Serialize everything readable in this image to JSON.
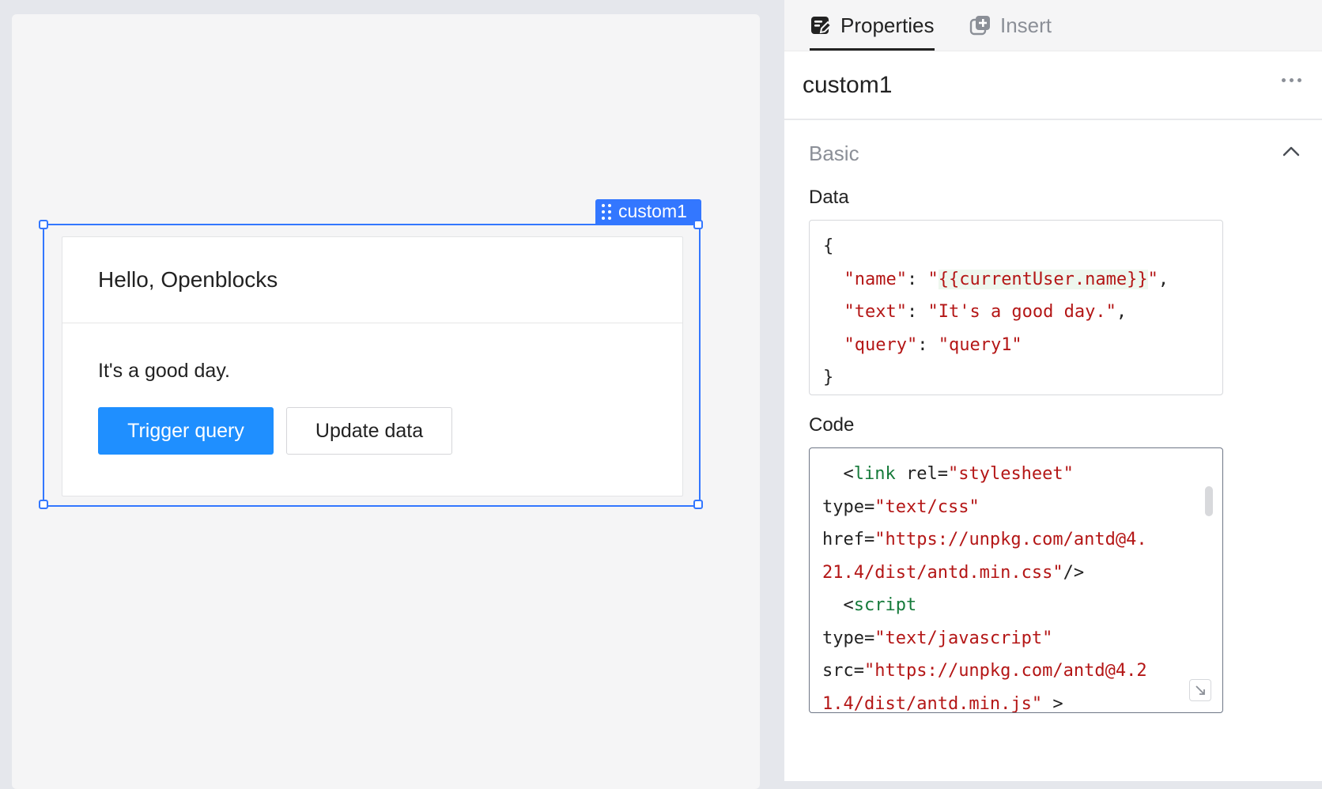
{
  "canvas": {
    "selection_label": "custom1",
    "card": {
      "title": "Hello, Openblocks",
      "text": "It's a good day.",
      "primary_button": "Trigger query",
      "secondary_button": "Update data"
    }
  },
  "panel": {
    "tabs": {
      "properties": "Properties",
      "insert": "Insert"
    },
    "component_name": "custom1",
    "section": {
      "title": "Basic",
      "data_label": "Data",
      "code_label": "Code"
    },
    "data_lines": [
      "{",
      "  \"name\": \"{{currentUser.name}}\",",
      "  \"text\": \"It's a good day.\",",
      "  \"query\": \"query1\"",
      "}"
    ],
    "code_lines": [
      "  <link rel=\"stylesheet\"",
      "type=\"text/css\"",
      "href=\"https://unpkg.com/antd@4.",
      "21.4/dist/antd.min.css\"/>",
      "  <script",
      "type=\"text/javascript\"",
      "src=\"https://unpkg.com/antd@4.2",
      "1.4/dist/antd.min.js\" >"
    ]
  },
  "colors": {
    "accent": "#3377ff",
    "primary_button": "#1f8fff",
    "string": "#b41616",
    "tag": "#157a3a"
  }
}
